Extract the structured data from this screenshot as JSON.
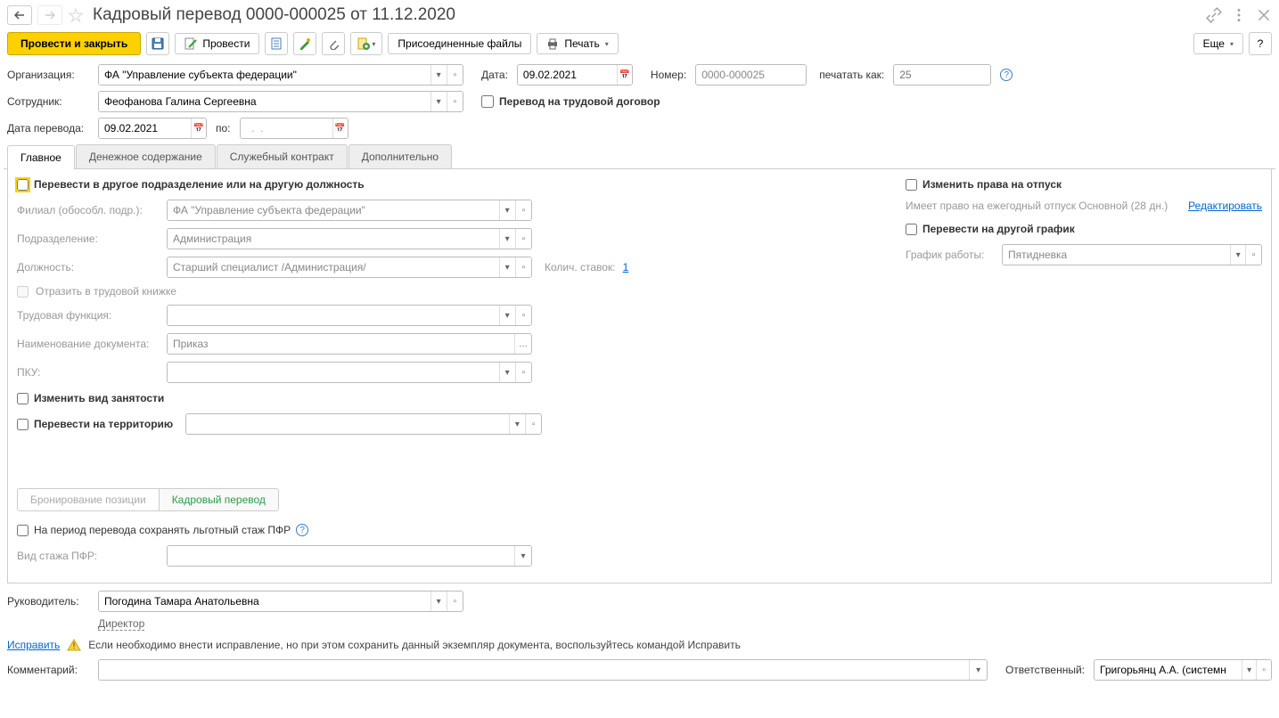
{
  "header": {
    "title": "Кадровый перевод 0000-000025 от 11.12.2020"
  },
  "toolbar": {
    "post_close": "Провести и закрыть",
    "post": "Провести",
    "attached_files": "Присоединенные файлы",
    "print": "Печать",
    "more": "Еще",
    "help": "?"
  },
  "form": {
    "org_label": "Организация:",
    "org_value": "ФА \"Управление субъекта федерации\"",
    "date_label": "Дата:",
    "date_value": "09.02.2021",
    "number_label": "Номер:",
    "number_value": "0000-000025",
    "print_as_label": "печатать как:",
    "print_as_placeholder": "25",
    "employee_label": "Сотрудник:",
    "employee_value": "Феофанова Галина Сергеевна",
    "to_labor_contract": "Перевод на трудовой договор",
    "transfer_date_label": "Дата перевода:",
    "transfer_date_value": "09.02.2021",
    "to_label": "по:",
    "to_value": "  .  .    "
  },
  "tabs": {
    "main": "Главное",
    "money": "Денежное содержание",
    "contract": "Служебный контракт",
    "extra": "Дополнительно"
  },
  "main_tab": {
    "transfer_check": "Перевести в другое подразделение или на другую должность",
    "branch_label": "Филиал (обособл. подр.):",
    "branch_value": "ФА \"Управление субъекта федерации\"",
    "dept_label": "Подразделение:",
    "dept_value": "Администрация",
    "position_label": "Должность:",
    "position_value": "Старший специалист /Администрация/",
    "rates_label": "Колич. ставок:",
    "rates_value": "1",
    "reflect_labor": "Отразить в трудовой книжке",
    "labor_func_label": "Трудовая функция:",
    "doc_name_label": "Наименование документа:",
    "doc_name_value": "Приказ",
    "pku_label": "ПКУ:",
    "change_employment": "Изменить вид занятости",
    "transfer_territory": "Перевести на территорию",
    "vacation_check": "Изменить права на отпуск",
    "vacation_text": "Имеет право на ежегодный отпуск Основной (28 дн.)",
    "edit_link": "Редактировать",
    "schedule_check": "Перевести на другой график",
    "schedule_label": "График работы:",
    "schedule_value": "Пятидневка",
    "booking_tab": "Бронирование позиции",
    "transfer_tab": "Кадровый перевод",
    "pfr_check": "На период перевода сохранять льготный стаж ПФР",
    "pfr_type_label": "Вид стажа ПФР:"
  },
  "footer": {
    "manager_label": "Руководитель:",
    "manager_value": "Погодина Тамара Анатольевна",
    "manager_post": "Директор",
    "correct_link": "Исправить",
    "correct_text": "Если необходимо внести исправление, но при этом сохранить данный экземпляр документа, воспользуйтесь командой Исправить",
    "comment_label": "Комментарий:",
    "responsible_label": "Ответственный:",
    "responsible_value": "Григорьянц А.А. (системн"
  }
}
